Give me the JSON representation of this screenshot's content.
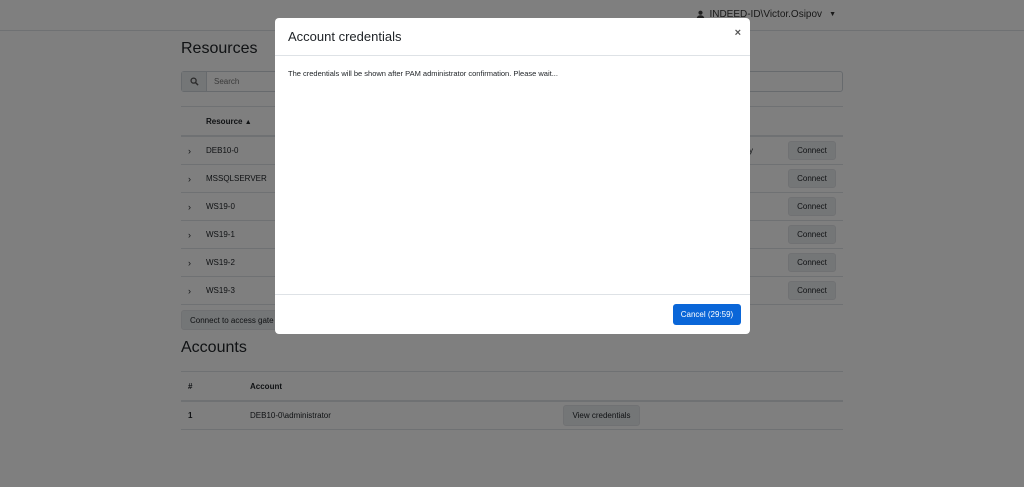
{
  "topbar": {
    "user_name": "INDEED-ID\\Victor.Osipov",
    "user_icon": "user-icon",
    "caret_icon": "caret-down-icon"
  },
  "resources": {
    "title": "Resources",
    "search_placeholder": "Search",
    "column_resource": "Resource",
    "sort_indicator": "▲",
    "rows": [
      {
        "name": "DEB10-0",
        "connect": "Connect",
        "partial_action": "y"
      },
      {
        "name": "MSSQLSERVER",
        "connect": "Connect"
      },
      {
        "name": "WS19-0",
        "connect": "Connect"
      },
      {
        "name": "WS19-1",
        "connect": "Connect"
      },
      {
        "name": "WS19-2",
        "connect": "Connect"
      },
      {
        "name": "WS19-3",
        "connect": "Connect"
      }
    ],
    "gateway_button": "Connect to access gate"
  },
  "accounts": {
    "title": "Accounts",
    "col_number": "#",
    "col_account": "Account",
    "rows": [
      {
        "number": "1",
        "account": "DEB10-0\\administrator",
        "action": "View credentials"
      }
    ]
  },
  "modal": {
    "title": "Account credentials",
    "close_label": "×",
    "message": "The credentials will be shown after PAM administrator confirmation. Please wait...",
    "cancel_label": "Cancel (29:59)",
    "primary_color": "#0a66d8"
  }
}
